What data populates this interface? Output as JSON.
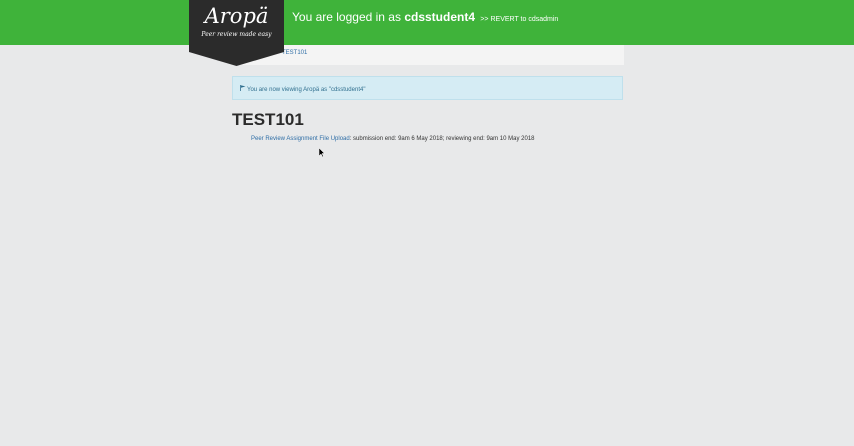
{
  "brand": {
    "name": "Aropä",
    "tagline": "Peer review made easy",
    "badge_color": "#2b2b2b"
  },
  "header": {
    "background_color": "#3fb33a",
    "logged_in_prefix": "You are logged in as ",
    "username": "cdsstudent4",
    "revert_label": ">> REVERT to cdsadmin"
  },
  "breadcrumb": {
    "course": "TEST101"
  },
  "alert": {
    "icon": "flag-icon",
    "message": "You are now viewing Aropä as \"cdsstudent4\""
  },
  "course": {
    "title": "TEST101"
  },
  "assignments": [
    {
      "link_text": "Peer Review Assignment File Upload",
      "details": ": submission end: 9am 6 May 2018; reviewing end: 9am 10 May 2018"
    }
  ]
}
